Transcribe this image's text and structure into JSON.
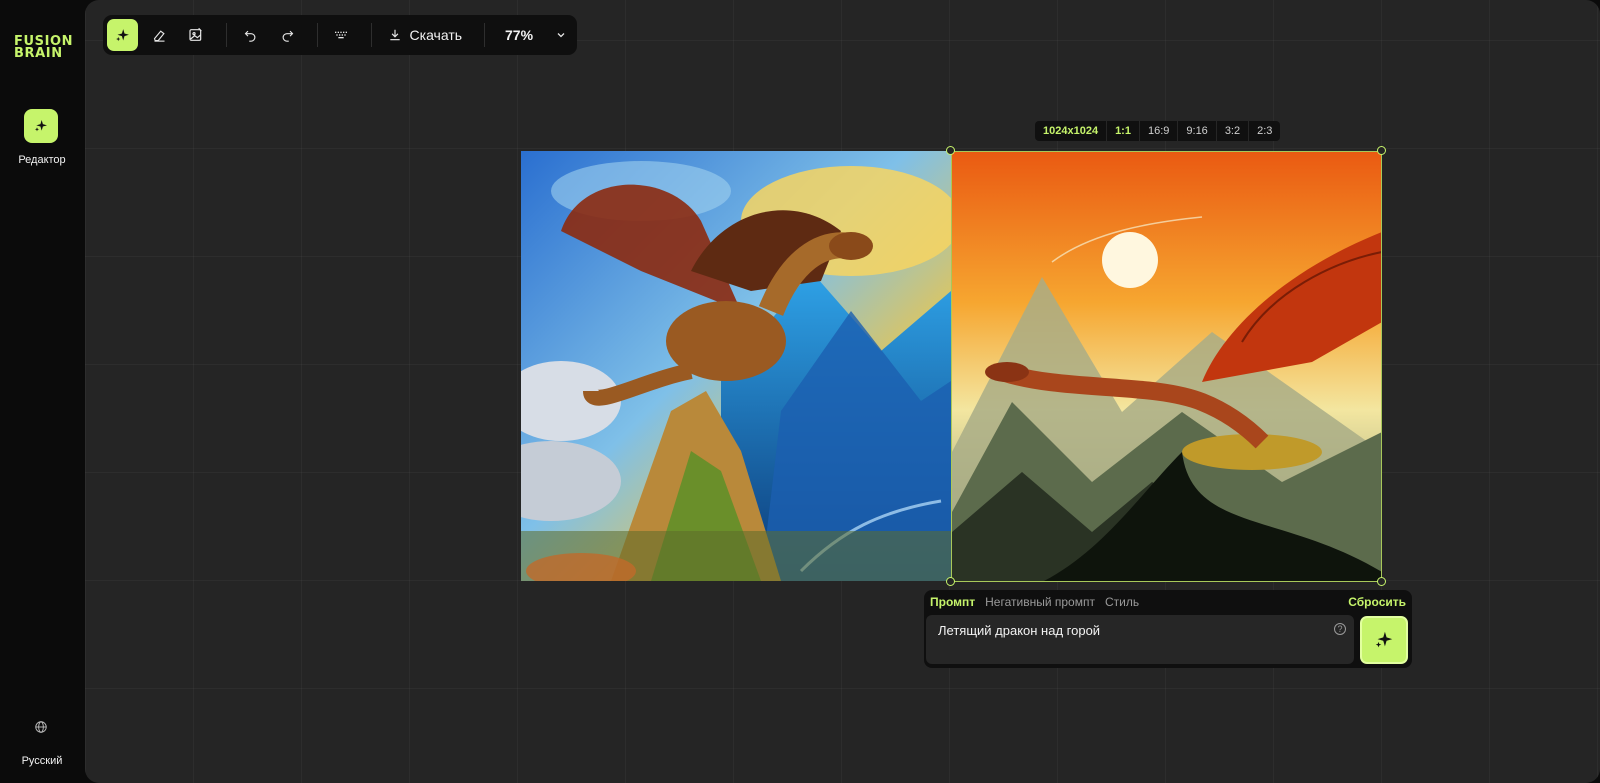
{
  "brand": {
    "logo_text": "FUSION\nBRAIN"
  },
  "sidebar": {
    "editor_label": "Редактор",
    "language_label": "Русский"
  },
  "toolbar": {
    "tools": [
      "sparkle-icon",
      "eraser-icon",
      "image-edit-icon",
      "undo-icon",
      "redo-icon",
      "keyboard-icon"
    ],
    "download_label": "Скачать",
    "zoom_value": "77%"
  },
  "size_bar": {
    "resolution": "1024x1024",
    "ratios": [
      "1:1",
      "16:9",
      "9:16",
      "3:2",
      "2:3"
    ],
    "selected_ratio": "1:1"
  },
  "prompt_panel": {
    "tabs": [
      "Промпт",
      "Негативный промпт",
      "Стиль"
    ],
    "active_tab": "Промпт",
    "reset_label": "Сбросить",
    "prompt_value": "Летящий дракон над горой",
    "help_glyph": "?"
  },
  "colors": {
    "accent": "#c6f46b",
    "canvas": "#252525",
    "panel": "#0f0f0f"
  }
}
